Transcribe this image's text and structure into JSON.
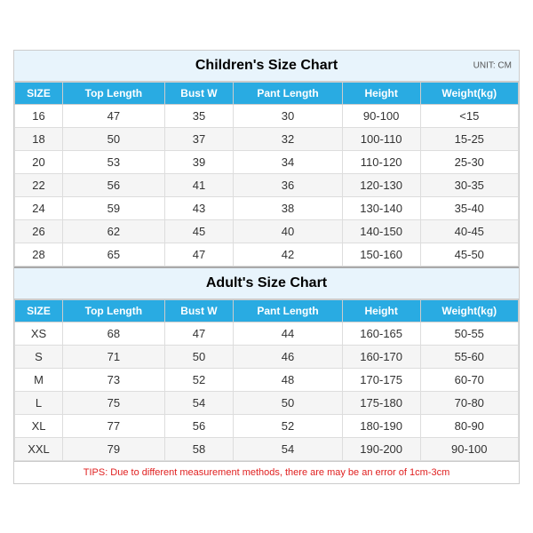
{
  "page": {
    "unit_label": "UNIT: CM",
    "children_section": {
      "title": "Children's Size Chart",
      "columns": [
        "SIZE",
        "Top Length",
        "Bust W",
        "Pant Length",
        "Height",
        "Weight(kg)"
      ],
      "rows": [
        [
          "16",
          "47",
          "35",
          "30",
          "90-100",
          "<15"
        ],
        [
          "18",
          "50",
          "37",
          "32",
          "100-110",
          "15-25"
        ],
        [
          "20",
          "53",
          "39",
          "34",
          "110-120",
          "25-30"
        ],
        [
          "22",
          "56",
          "41",
          "36",
          "120-130",
          "30-35"
        ],
        [
          "24",
          "59",
          "43",
          "38",
          "130-140",
          "35-40"
        ],
        [
          "26",
          "62",
          "45",
          "40",
          "140-150",
          "40-45"
        ],
        [
          "28",
          "65",
          "47",
          "42",
          "150-160",
          "45-50"
        ]
      ]
    },
    "adult_section": {
      "title": "Adult's Size Chart",
      "columns": [
        "SIZE",
        "Top Length",
        "Bust W",
        "Pant Length",
        "Height",
        "Weight(kg)"
      ],
      "rows": [
        [
          "XS",
          "68",
          "47",
          "44",
          "160-165",
          "50-55"
        ],
        [
          "S",
          "71",
          "50",
          "46",
          "160-170",
          "55-60"
        ],
        [
          "M",
          "73",
          "52",
          "48",
          "170-175",
          "60-70"
        ],
        [
          "L",
          "75",
          "54",
          "50",
          "175-180",
          "70-80"
        ],
        [
          "XL",
          "77",
          "56",
          "52",
          "180-190",
          "80-90"
        ],
        [
          "XXL",
          "79",
          "58",
          "54",
          "190-200",
          "90-100"
        ]
      ]
    },
    "tips": "TIPS: Due to different measurement methods, there are may be an error of 1cm-3cm"
  }
}
